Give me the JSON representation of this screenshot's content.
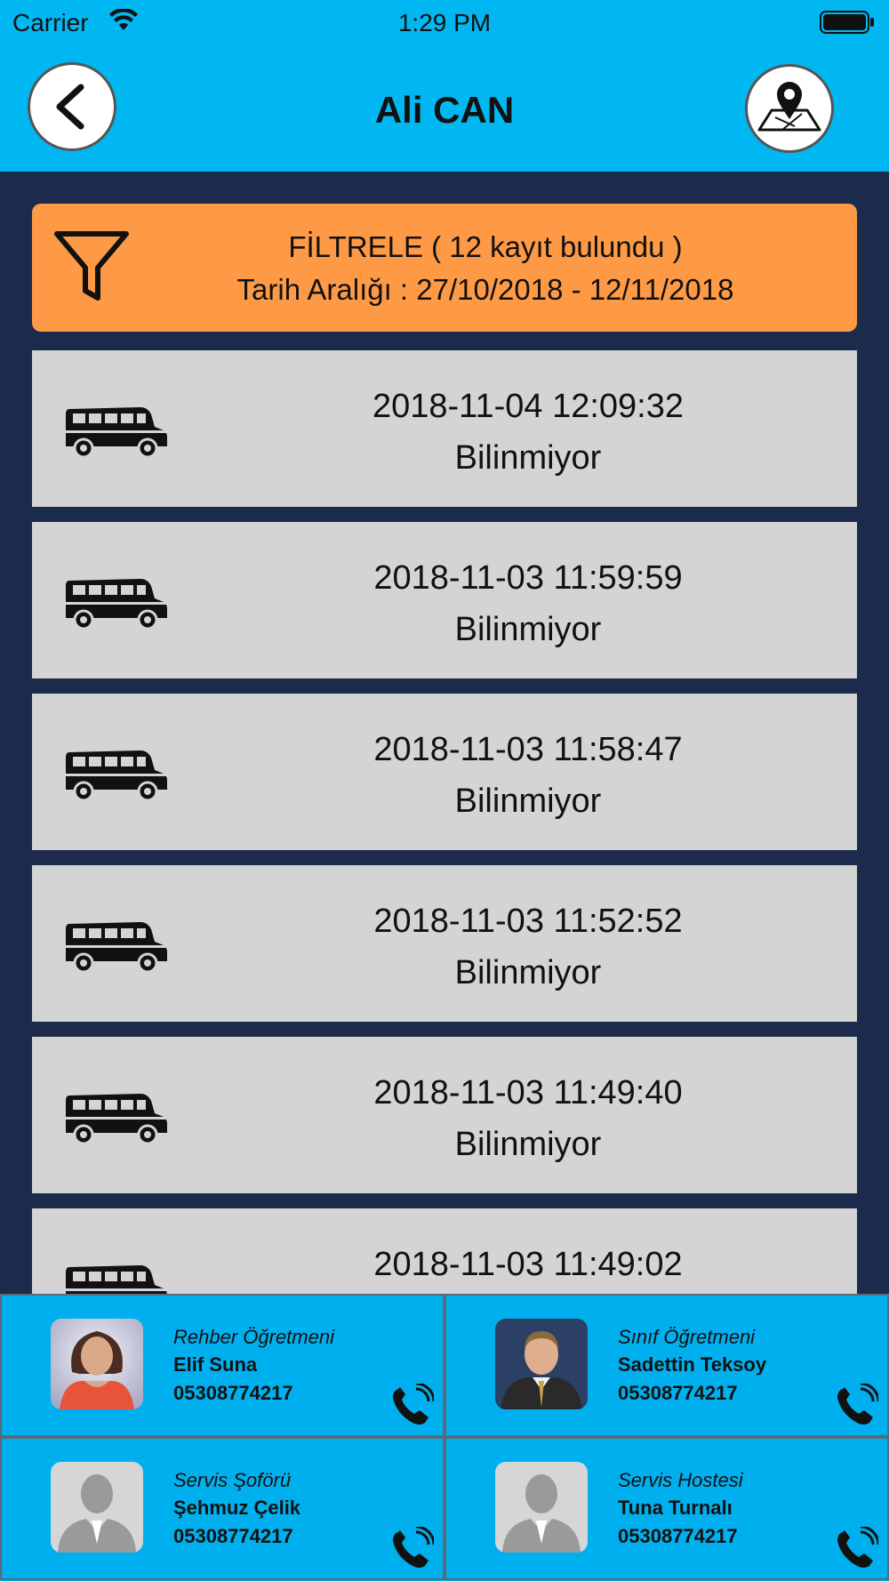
{
  "status_bar": {
    "carrier": "Carrier",
    "time": "1:29 PM"
  },
  "header": {
    "title": "Ali CAN",
    "back_icon": "chevron-left-icon",
    "map_icon": "map-pin-icon"
  },
  "filter": {
    "icon": "filter-funnel-icon",
    "line1": "FİLTRELE ( 12 kayıt bulundu )",
    "line2": "Tarih Aralığı : 27/10/2018 - 12/11/2018"
  },
  "records": [
    {
      "datetime": "2018-11-04 12:09:32",
      "location": "Bilinmiyor"
    },
    {
      "datetime": "2018-11-03 11:59:59",
      "location": "Bilinmiyor"
    },
    {
      "datetime": "2018-11-03 11:58:47",
      "location": "Bilinmiyor"
    },
    {
      "datetime": "2018-11-03 11:52:52",
      "location": "Bilinmiyor"
    },
    {
      "datetime": "2018-11-03 11:49:40",
      "location": "Bilinmiyor"
    },
    {
      "datetime": "2018-11-03 11:49:02",
      "location": ""
    }
  ],
  "contacts": [
    {
      "role": "Rehber Öğretmeni",
      "name": "Elif Suna",
      "phone": "05308774217",
      "avatar": "female-photo"
    },
    {
      "role": "Sınıf Öğretmeni",
      "name": "Sadettin Teksoy",
      "phone": "05308774217",
      "avatar": "male-photo"
    },
    {
      "role": "Servis Şoförü",
      "name": "Şehmuz Çelik",
      "phone": "05308774217",
      "avatar": "placeholder-silhouette"
    },
    {
      "role": "Servis Hostesi",
      "name": "Tuna Turnalı",
      "phone": "05308774217",
      "avatar": "placeholder-silhouette"
    }
  ],
  "colors": {
    "header_blue": "#00b7f1",
    "background_navy": "#1c2b4b",
    "filter_orange": "#fe9a45",
    "row_gray": "#d4d4d4"
  }
}
